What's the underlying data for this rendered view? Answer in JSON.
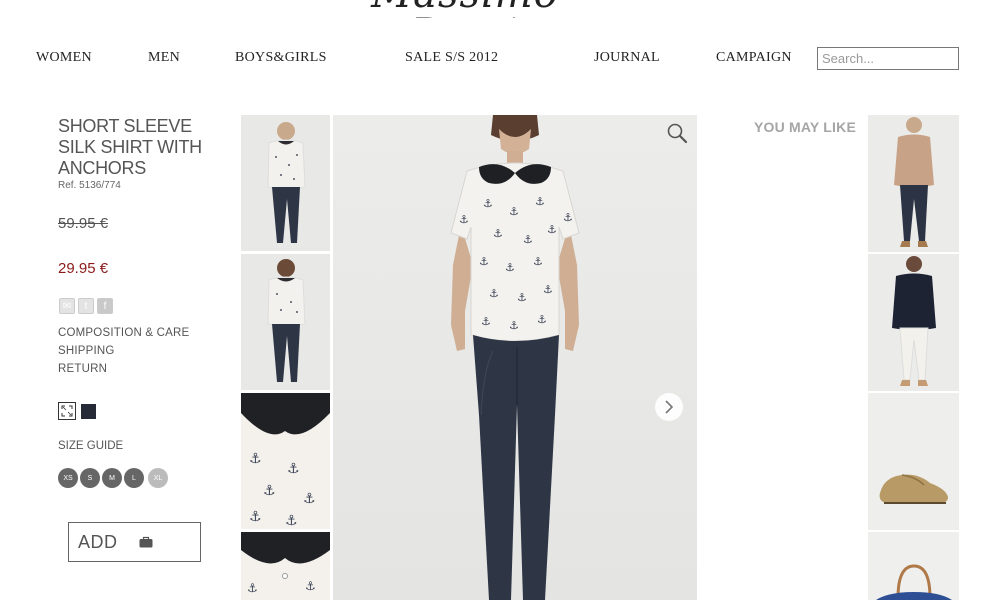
{
  "brand": {
    "logo_text": "Massimo Dutti"
  },
  "nav": {
    "items": [
      {
        "label": "WOMEN"
      },
      {
        "label": "MEN"
      },
      {
        "label": "BOYS&GIRLS"
      },
      {
        "label": "SALE S/S 2012"
      },
      {
        "label": "JOURNAL"
      },
      {
        "label": "CAMPAIGN"
      }
    ],
    "search_placeholder": "Search..."
  },
  "product": {
    "title": "SHORT SLEEVE SILK SHIRT WITH ANCHORS",
    "ref": "Ref. 5136/774",
    "old_price": "59.95 €",
    "new_price": "29.95 €",
    "share": [
      {
        "icon": "email-icon",
        "glyph": "✉"
      },
      {
        "icon": "twitter-icon",
        "glyph": "t"
      },
      {
        "icon": "facebook-icon",
        "glyph": "f"
      }
    ],
    "links": [
      "COMPOSITION & CARE",
      "SHIPPING",
      "RETURN"
    ],
    "selected_color": "#252a36",
    "size_guide_label": "SIZE GUIDE",
    "sizes": [
      {
        "label": "XS",
        "available": true
      },
      {
        "label": "S",
        "available": true
      },
      {
        "label": "M",
        "available": true
      },
      {
        "label": "L",
        "available": true
      },
      {
        "label": "XL",
        "available": false
      }
    ],
    "add_label": "ADD"
  },
  "recommendations": {
    "title": "YOU MAY LIKE"
  },
  "colors": {
    "price_sale": "#8b1a1a",
    "heading_grey": "#a5a5a5",
    "jeans": "#2e3646"
  }
}
